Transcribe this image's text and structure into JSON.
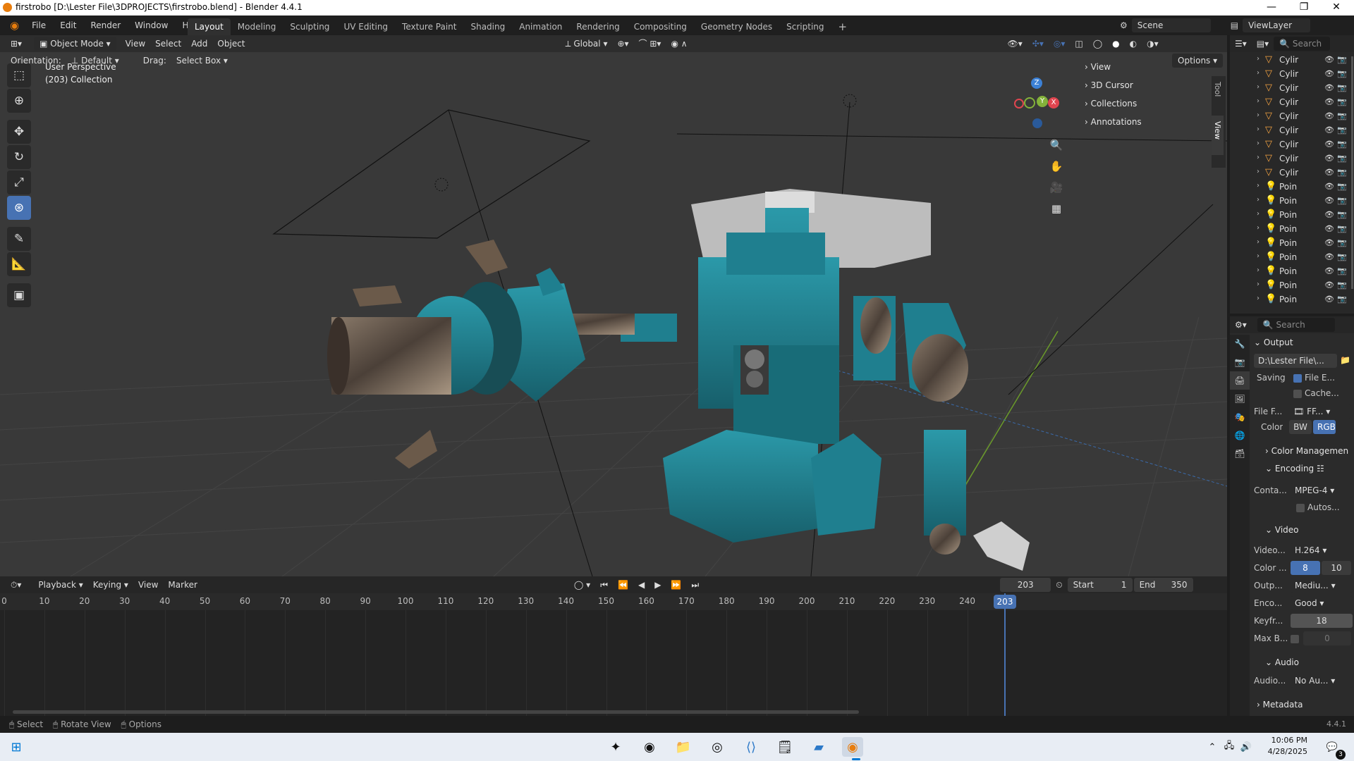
{
  "title_bar": {
    "title": "firstrobo [D:\\Lester File\\3DPROJECTS\\firstrobo.blend] - Blender 4.4.1",
    "minimize": "—",
    "restore": "❐",
    "close": "✕"
  },
  "menu": {
    "items": [
      "File",
      "Edit",
      "Render",
      "Window",
      "Help"
    ],
    "workspaces": [
      "Layout",
      "Modeling",
      "Sculpting",
      "UV Editing",
      "Texture Paint",
      "Shading",
      "Animation",
      "Rendering",
      "Compositing",
      "Geometry Nodes",
      "Scripting"
    ],
    "active_workspace": "Layout",
    "add_workspace": "+",
    "scene": "Scene",
    "view_layer": "ViewLayer"
  },
  "viewport": {
    "mode": "Object Mode",
    "menus": [
      "View",
      "Select",
      "Add",
      "Object"
    ],
    "transform_orientation": "Global",
    "options_label": "Options",
    "orientation_label": "Orientation:",
    "orientation_value": "Default",
    "drag_label": "Drag:",
    "drag_value": "Select Box",
    "overlay_line1": "User Perspective",
    "overlay_line2": "(203) Collection",
    "side_tabs": [
      "Tool",
      "View"
    ],
    "n_panels": [
      "View",
      "3D Cursor",
      "Collections",
      "Annotations"
    ],
    "gizmo": {
      "x": "X",
      "y": "Y",
      "z": "Z"
    },
    "colors": {
      "teal": "#1f7f8f",
      "accent": "#4772b3",
      "gizmo_x": "#e0454f",
      "gizmo_y": "#84b23a",
      "gizmo_z": "#3c81d6"
    }
  },
  "timeline": {
    "menus": [
      "Playback",
      "Keying",
      "View",
      "Marker"
    ],
    "current_frame": "203",
    "start_label": "Start",
    "start": "1",
    "end_label": "End",
    "end": "350",
    "ruler": [
      "0",
      "10",
      "20",
      "30",
      "40",
      "50",
      "60",
      "70",
      "80",
      "90",
      "100",
      "110",
      "120",
      "130",
      "140",
      "150",
      "160",
      "170",
      "180",
      "190",
      "200",
      "210",
      "220",
      "230",
      "240"
    ]
  },
  "outliner": {
    "search_placeholder": "Search",
    "rows": [
      {
        "name": "Cylir",
        "type": "mesh"
      },
      {
        "name": "Cylir",
        "type": "mesh"
      },
      {
        "name": "Cylir",
        "type": "mesh"
      },
      {
        "name": "Cylir",
        "type": "mesh"
      },
      {
        "name": "Cylir",
        "type": "mesh"
      },
      {
        "name": "Cylir",
        "type": "mesh"
      },
      {
        "name": "Cylir",
        "type": "mesh"
      },
      {
        "name": "Cylir",
        "type": "mesh"
      },
      {
        "name": "Cylir",
        "type": "mesh"
      },
      {
        "name": "Poin",
        "type": "light"
      },
      {
        "name": "Poin",
        "type": "light"
      },
      {
        "name": "Poin",
        "type": "light"
      },
      {
        "name": "Poin",
        "type": "light"
      },
      {
        "name": "Poin",
        "type": "light"
      },
      {
        "name": "Poin",
        "type": "light"
      },
      {
        "name": "Poin",
        "type": "light"
      },
      {
        "name": "Poin",
        "type": "light"
      },
      {
        "name": "Poin",
        "type": "light"
      }
    ]
  },
  "properties": {
    "search_placeholder": "Search",
    "output_section": "Output",
    "output_path": "D:\\Lester File\\...",
    "saving_label": "Saving",
    "file_extensions": "File E...",
    "cache_result": "Cache...",
    "file_format_label": "File F...",
    "file_format": "FF...",
    "color_label": "Color",
    "color_bw": "BW",
    "color_rgb": "RGB",
    "color_management": "Color Managemen",
    "encoding": "Encoding",
    "container_label": "Conta...",
    "container": "MPEG-4",
    "autosplit": "Autos...",
    "video_section": "Video",
    "video_codec_label": "Video...",
    "video_codec": "H.264",
    "color_depth_label": "Color ...",
    "depth_8": "8",
    "depth_10": "10",
    "output_quality_label": "Outp...",
    "output_quality": "Mediu...",
    "encoding_speed_label": "Enco...",
    "encoding_speed": "Good",
    "keyframe_label": "Keyfr...",
    "keyframe_interval": "18",
    "max_b_label": "Max B...",
    "max_b": "0",
    "audio_section": "Audio",
    "audio_codec_label": "Audio...",
    "audio_codec": "No Au...",
    "metadata_section": "Metadata"
  },
  "status": {
    "select": "Select",
    "rotate_view": "Rotate View",
    "options": "Options",
    "version": "4.4.1"
  },
  "taskbar": {
    "time": "10:06 PM",
    "date": "4/28/2025",
    "notifications": "3"
  }
}
